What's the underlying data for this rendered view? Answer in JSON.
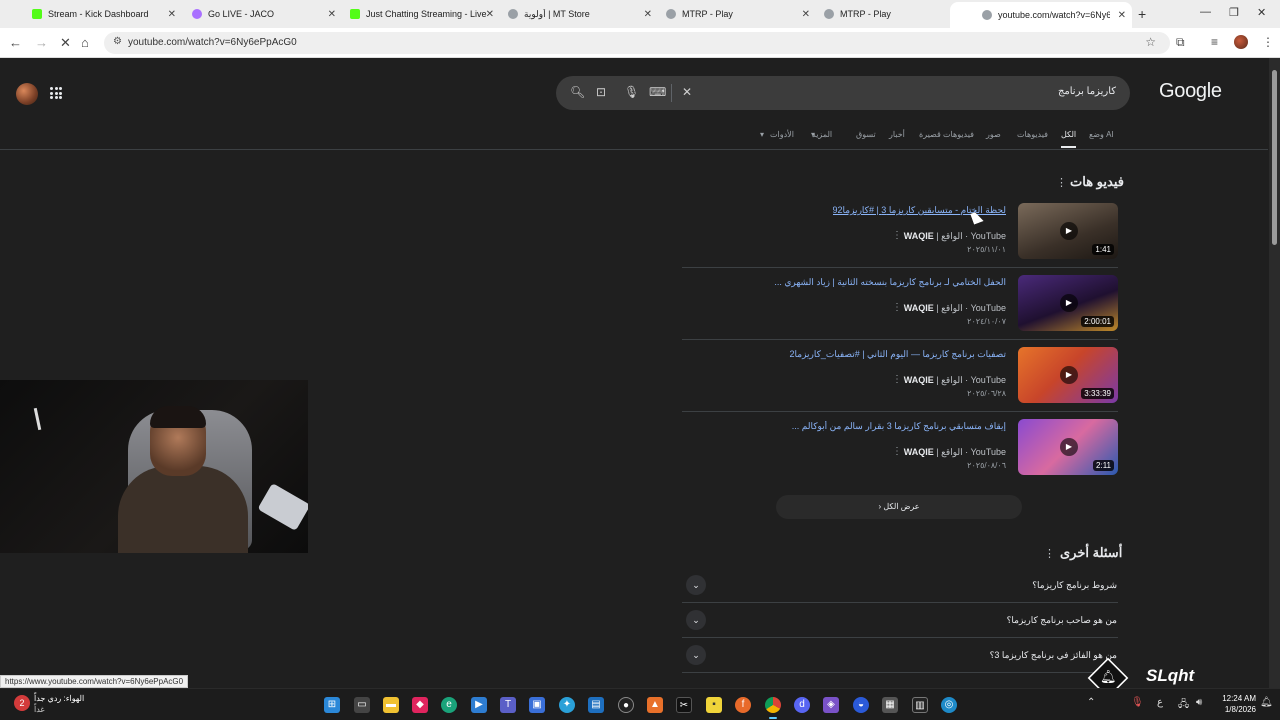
{
  "browser": {
    "tabs": [
      {
        "title": "Stream - Kick Dashboard",
        "color": "#53fc18"
      },
      {
        "title": "Go LIVE - JACO",
        "color": "#a970ff"
      },
      {
        "title": "Just Chatting Streaming - Live",
        "color": "#53fc18"
      },
      {
        "title": "أولوية | MT Store",
        "color": "#9aa0a6"
      },
      {
        "title": "MTRP - Play",
        "color": "#9aa0a6"
      },
      {
        "title": "MTRP - Play",
        "color": "#9aa0a6"
      },
      {
        "title": "youtube.com/watch?v=6Ny6eP",
        "color": "#9aa0a6"
      }
    ],
    "new_tab": "+",
    "url": "youtube.com/watch?v=6Ny6ePpAcG0"
  },
  "google": {
    "logo": "Google",
    "query": "كاريزما برنامج",
    "tabs": [
      "وضع AI",
      "الكل",
      "فيديوهات",
      "صور",
      "فيديوهات قصيرة",
      "أخبار",
      "تسوق",
      "المزيد",
      "الأدوات"
    ],
    "active_tab": "الكل"
  },
  "videos": {
    "section_title": "فيديو هات",
    "items": [
      {
        "title": "لحظة الختام - متسابقين كاريزما 3 | #كاريزما92",
        "source": "YouTube",
        "channel": "WAQIE",
        "channel_sub": "الواقع",
        "date": "٢٠٢٥/١١/٠١",
        "duration": "1:41",
        "thumb": "#5a5046"
      },
      {
        "title": "الحفل الختامي لـ برنامج كاريزما بنسخته الثانية | زياد الشهري ...",
        "source": "YouTube",
        "channel": "WAQIE",
        "channel_sub": "الواقع",
        "date": "٢٠٢٤/١٠/٠٧",
        "duration": "2:00:01",
        "thumb": "#3a1f5a"
      },
      {
        "title": "تصفيات برنامج كاريزما — اليوم الثاني | #تصفيات_كاريزما2",
        "source": "YouTube",
        "channel": "WAQIE",
        "channel_sub": "الواقع",
        "date": "٢٠٢٥/٠٦/٢٨",
        "duration": "3:33:39",
        "thumb": "#d65a2a"
      },
      {
        "title": "إيقاف متسابقي برنامج كاريزما 3 بقرار سالم من أبوكالم ...",
        "source": "YouTube",
        "channel": "WAQIE",
        "channel_sub": "الواقع",
        "date": "٢٠٢٥/٠٨/٠٦",
        "duration": "2:11",
        "thumb": "#6a3fa8"
      }
    ],
    "show_all": "عرض الكل"
  },
  "faq": {
    "section_title": "أسئلة أخرى",
    "items": [
      "شروط برنامج كاريزما؟",
      "من هو صاحب برنامج كاريزما؟",
      "من هو الفائز في برنامج كاريزما 3؟"
    ]
  },
  "status_url": "https://www.youtube.com/watch?v=6Ny6ePpAcG0",
  "overlay": {
    "brand": "SLqht"
  },
  "taskbar": {
    "weather_line1": "الهواء: ردي جداً",
    "weather_line2": "غداً",
    "weather_badge": "2",
    "lang": "ع",
    "time": "12:24 AM",
    "date": "1/8/2026"
  }
}
